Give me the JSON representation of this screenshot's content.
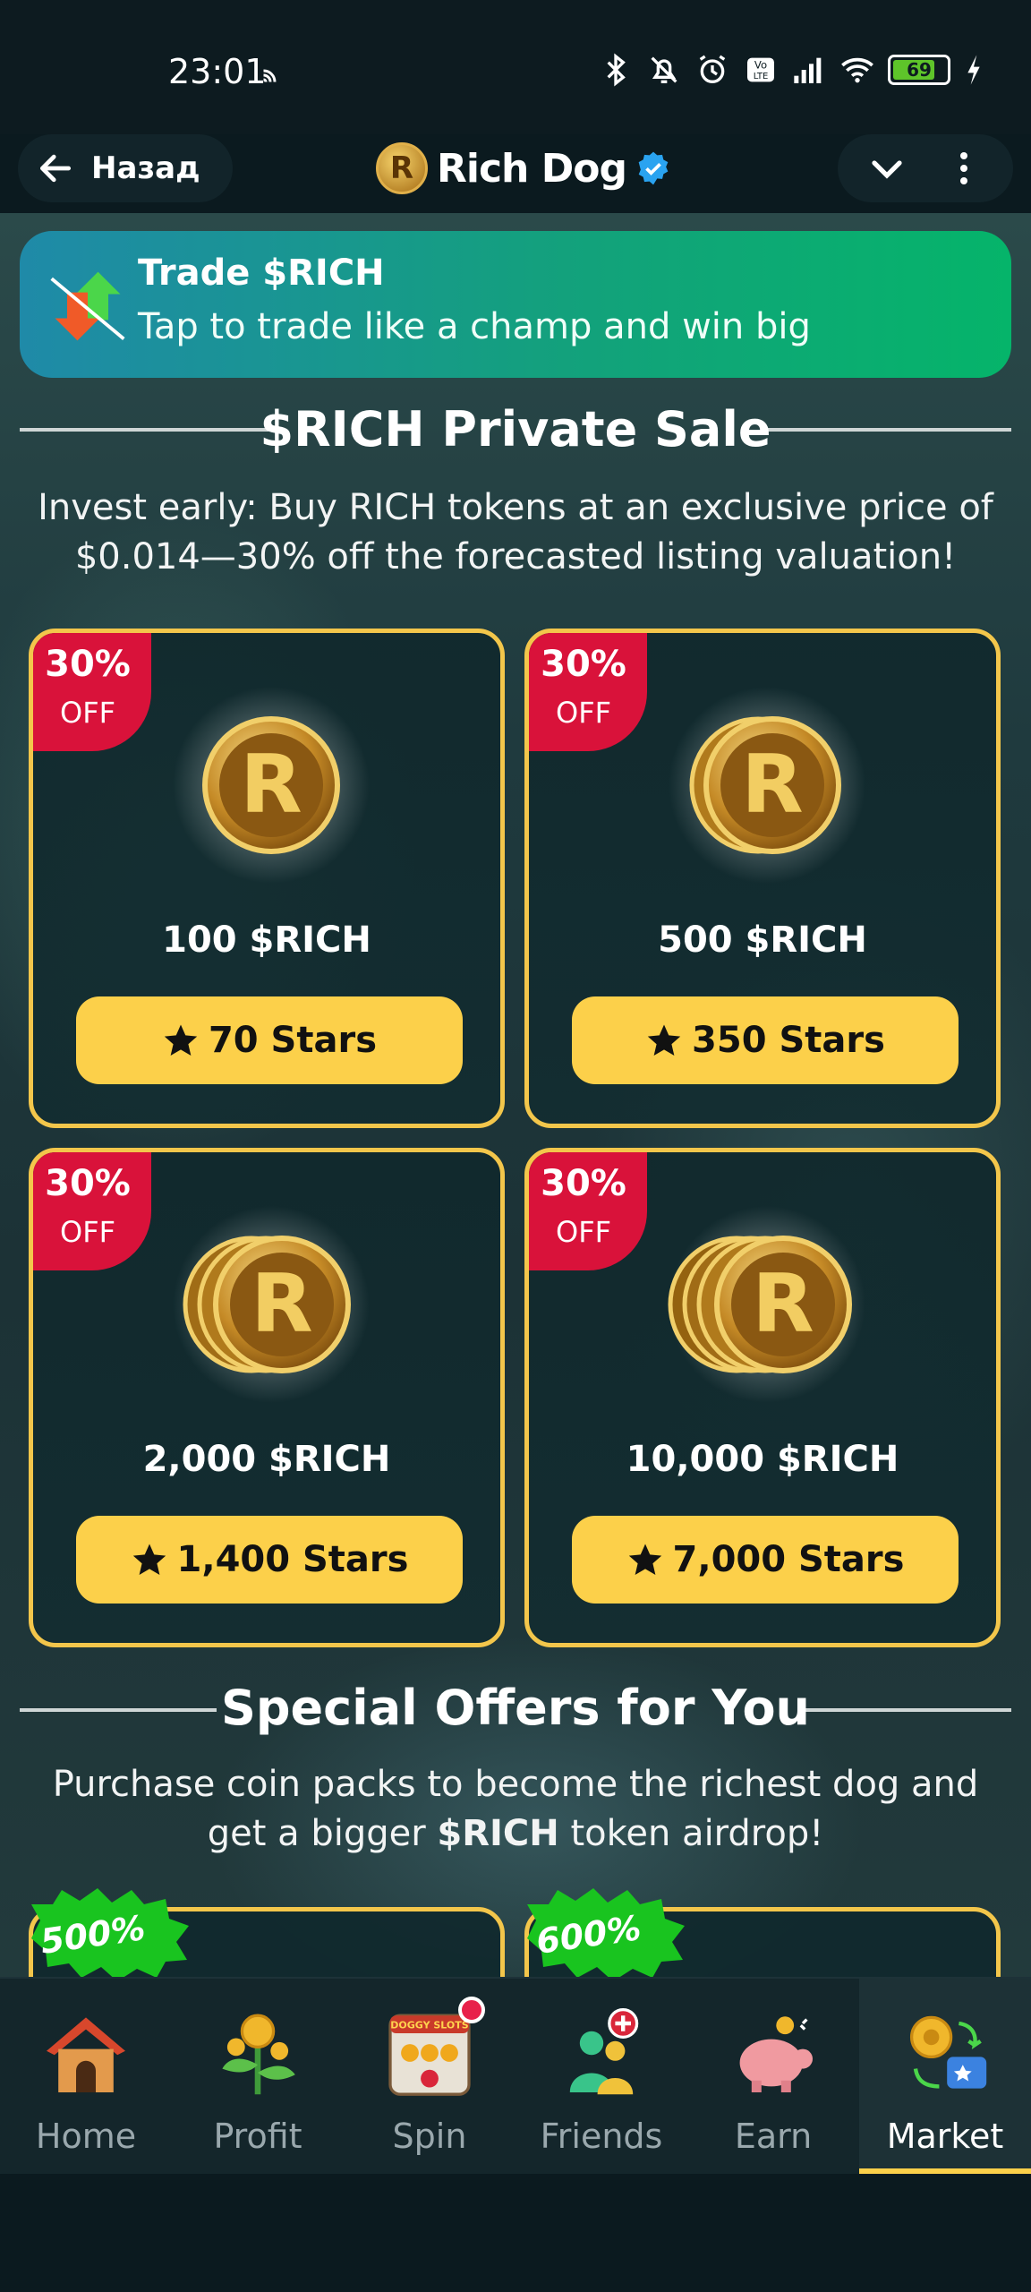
{
  "status_bar": {
    "time": "23:01",
    "battery": "69"
  },
  "header": {
    "back_label": "Назад",
    "title": "Rich Dog"
  },
  "trade_banner": {
    "title": "Trade $RICH",
    "subtitle": "Tap to trade like a champ and win big"
  },
  "private_sale": {
    "title": "$RICH Private Sale",
    "description_line1": "Invest early: Buy RICH tokens at an exclusive price of",
    "description_line2": "$0.014—30% off the forecasted listing valuation!",
    "packs": [
      {
        "badge_pct": "30%",
        "badge_off": "OFF",
        "amount": "100 $RICH",
        "price": "70 Stars"
      },
      {
        "badge_pct": "30%",
        "badge_off": "OFF",
        "amount": "500 $RICH",
        "price": "350 Stars"
      },
      {
        "badge_pct": "30%",
        "badge_off": "OFF",
        "amount": "2,000 $RICH",
        "price": "1,400 Stars"
      },
      {
        "badge_pct": "30%",
        "badge_off": "OFF",
        "amount": "10,000 $RICH",
        "price": "7,000 Stars"
      }
    ]
  },
  "special_offers": {
    "title": "Special Offers for You",
    "description_line1": "Purchase coin packs to become the richest dog and",
    "description_pre": "get a bigger ",
    "description_bold": "$RICH",
    "description_post": " token airdrop!",
    "offers": [
      {
        "badge": "500%"
      },
      {
        "badge": "600%"
      }
    ]
  },
  "bottom_nav": {
    "items": [
      {
        "label": "Home"
      },
      {
        "label": "Profit"
      },
      {
        "label": "Spin",
        "icon_text": "DOGGY SLOTS"
      },
      {
        "label": "Friends"
      },
      {
        "label": "Earn"
      },
      {
        "label": "Market"
      }
    ]
  },
  "colors": {
    "accent": "#fcd04a",
    "badge_red": "#d9123a",
    "badge_green": "#19c41f",
    "card_border": "#f3c64b"
  }
}
